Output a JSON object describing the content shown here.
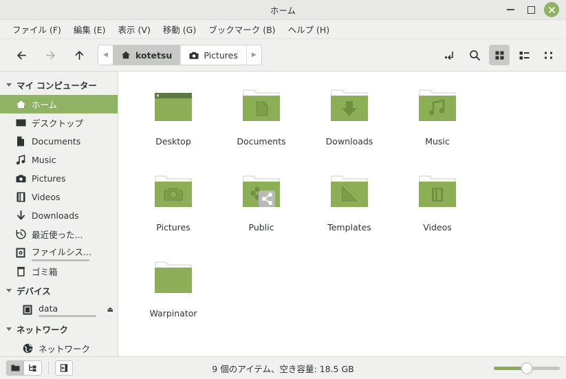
{
  "window": {
    "title": "ホーム",
    "minimize_label": "最小化",
    "maximize_label": "最大化",
    "close_label": "×"
  },
  "menubar": {
    "items": [
      {
        "label": "ファイル (F)",
        "name": "menu-file"
      },
      {
        "label": "編集 (E)",
        "name": "menu-edit"
      },
      {
        "label": "表示 (V)",
        "name": "menu-view"
      },
      {
        "label": "移動 (G)",
        "name": "menu-go"
      },
      {
        "label": "ブックマーク (B)",
        "name": "menu-bookmarks"
      },
      {
        "label": "ヘルプ (H)",
        "name": "menu-help"
      }
    ]
  },
  "toolbar": {
    "back_label": "←",
    "forward_label": "→",
    "up_label": "↑",
    "breadcrumb": {
      "scroll_left": "◀",
      "scroll_right": "▶",
      "crumbs": [
        {
          "label": "kotetsu",
          "icon": "home-icon",
          "active": true
        },
        {
          "label": "Pictures",
          "icon": "camera-icon",
          "active": false
        }
      ]
    },
    "buttons": [
      {
        "name": "path-entry-toggle-button",
        "icon": "path-entry-icon"
      },
      {
        "name": "search-button",
        "icon": "search-icon"
      },
      {
        "name": "icon-view-button",
        "icon": "grid-view-icon",
        "active": true
      },
      {
        "name": "list-view-button",
        "icon": "list-view-icon",
        "active": false
      },
      {
        "name": "compact-view-button",
        "icon": "compact-view-icon",
        "active": false
      }
    ]
  },
  "sidebar": {
    "sections": [
      {
        "name": "my-computer",
        "title": "マイ コンピューター",
        "items": [
          {
            "label": "ホーム",
            "icon": "home-icon",
            "selected": true
          },
          {
            "label": "デスクトップ",
            "icon": "desktop-icon",
            "selected": false
          },
          {
            "label": "Documents",
            "icon": "document-icon",
            "selected": false
          },
          {
            "label": "Music",
            "icon": "music-note-icon",
            "selected": false
          },
          {
            "label": "Pictures",
            "icon": "camera-icon",
            "selected": false
          },
          {
            "label": "Videos",
            "icon": "film-icon",
            "selected": false
          },
          {
            "label": "Downloads",
            "icon": "download-arrow-icon",
            "selected": false
          },
          {
            "label": "最近使った...",
            "icon": "recent-clock-icon",
            "selected": false
          },
          {
            "label": "ファイルシス...",
            "icon": "filesystem-icon",
            "selected": false,
            "usage_percent": 35
          },
          {
            "label": "ゴミ箱",
            "icon": "trash-icon",
            "selected": false
          }
        ]
      },
      {
        "name": "devices",
        "title": "デバイス",
        "items": [
          {
            "label": "data",
            "icon": "drive-icon",
            "selected": false,
            "usage_percent": 0,
            "eject": "⏏"
          }
        ]
      },
      {
        "name": "network",
        "title": "ネットワーク",
        "items": [
          {
            "label": "ネットワーク",
            "icon": "globe-icon",
            "selected": false
          }
        ]
      }
    ]
  },
  "content": {
    "files": [
      {
        "label": "Desktop",
        "icon": "desktop-folder-icon"
      },
      {
        "label": "Documents",
        "icon": "documents-folder-icon"
      },
      {
        "label": "Downloads",
        "icon": "downloads-folder-icon"
      },
      {
        "label": "Music",
        "icon": "music-folder-icon"
      },
      {
        "label": "Pictures",
        "icon": "pictures-folder-icon"
      },
      {
        "label": "Public",
        "icon": "public-folder-icon"
      },
      {
        "label": "Templates",
        "icon": "templates-folder-icon"
      },
      {
        "label": "Videos",
        "icon": "videos-folder-icon"
      },
      {
        "label": "Warpinator",
        "icon": "plain-folder-icon"
      }
    ]
  },
  "statusbar": {
    "buttons": [
      {
        "name": "folder-view-button",
        "icon": "folder-icon",
        "active": true
      },
      {
        "name": "tree-view-button",
        "icon": "tree-icon",
        "active": false
      },
      {
        "name": "sidebar-toggle-button",
        "icon": "sidebar-icon",
        "active": false
      }
    ],
    "status_text": "9 個のアイテム、空き容量: 18.5 GB",
    "zoom_percent": 50
  },
  "colors": {
    "accent_green": "#8fb264",
    "folder_green": "#8bae56",
    "folder_dark": "#5c7a3f",
    "chrome_bg": "#f0f0ef",
    "content_bg": "#ffffff",
    "text": "#2e3436"
  }
}
